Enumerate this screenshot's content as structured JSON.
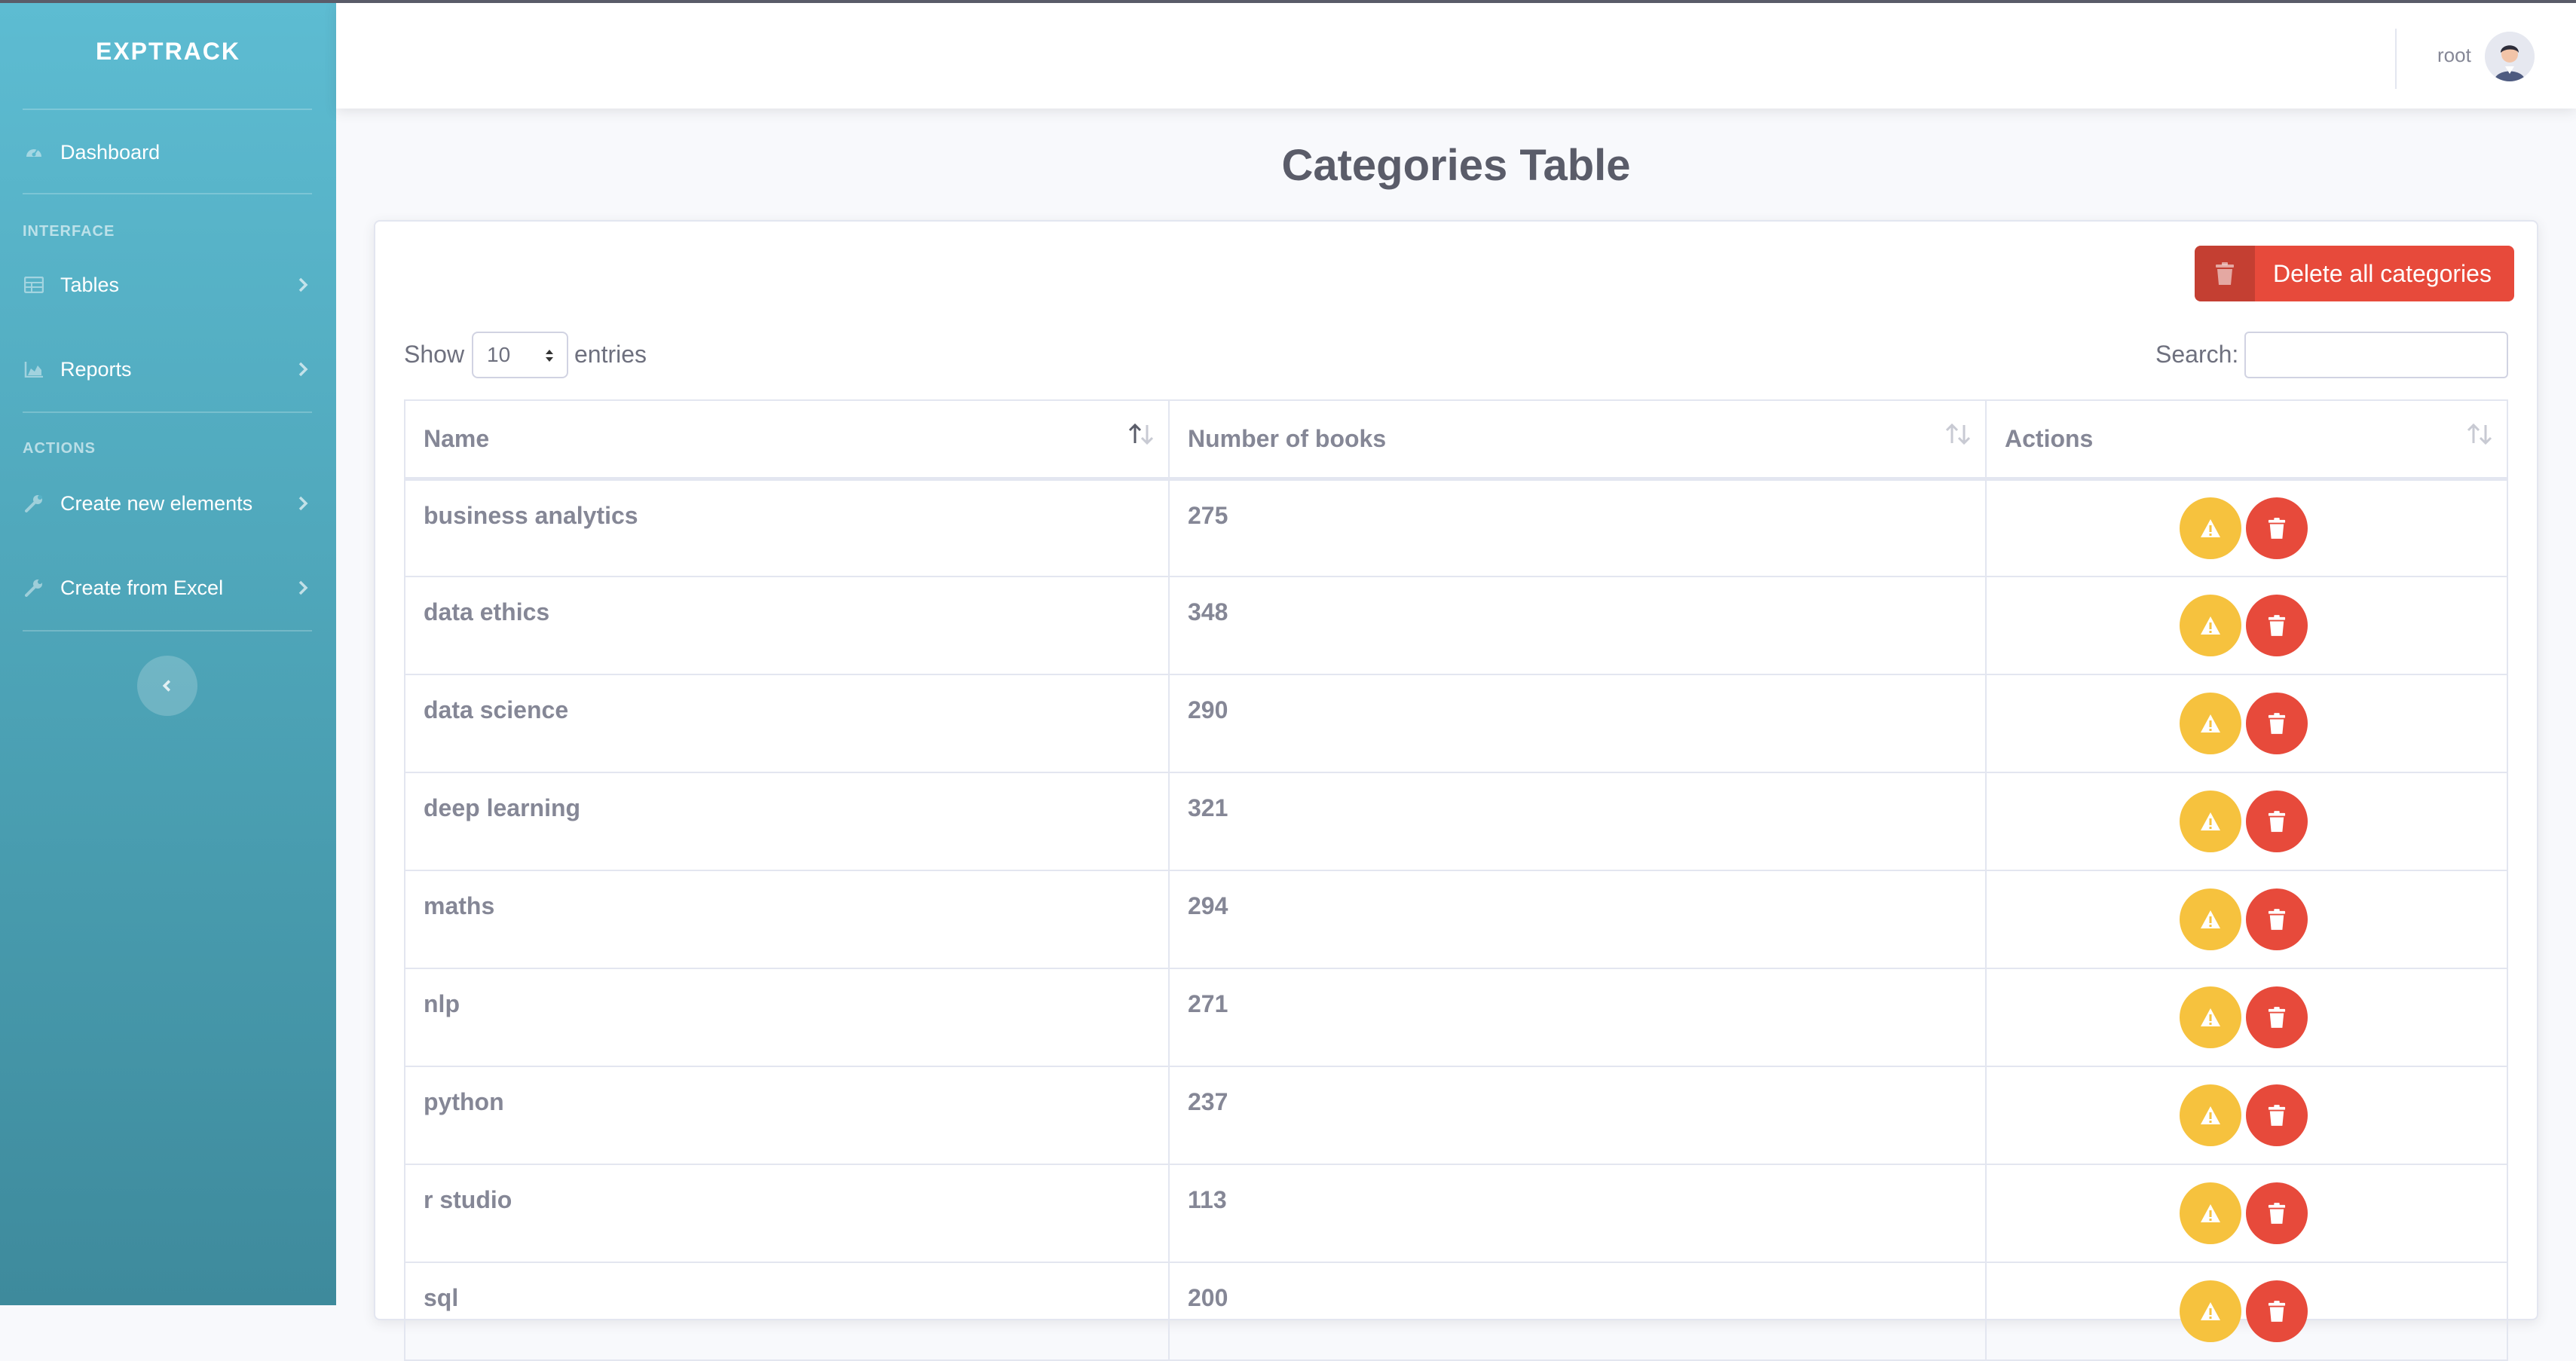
{
  "app": {
    "brand": "EXPTRACK"
  },
  "sidebar": {
    "dashboard": "Dashboard",
    "heading_interface": "INTERFACE",
    "tables": "Tables",
    "reports": "Reports",
    "heading_actions": "ACTIONS",
    "create_new": "Create new elements",
    "create_excel": "Create from Excel"
  },
  "topbar": {
    "user": "root"
  },
  "page": {
    "title": "Categories Table"
  },
  "toolbar": {
    "delete_all_label": "Delete all categories"
  },
  "table_controls": {
    "show": "Show",
    "length_value": "10",
    "entries": "entries",
    "search_label": "Search:",
    "search_value": ""
  },
  "table": {
    "headers": [
      "Name",
      "Number of books",
      "Actions"
    ],
    "rows": [
      {
        "name": "business analytics",
        "books": "275"
      },
      {
        "name": "data ethics",
        "books": "348"
      },
      {
        "name": "data science",
        "books": "290"
      },
      {
        "name": "deep learning",
        "books": "321"
      },
      {
        "name": "maths",
        "books": "294"
      },
      {
        "name": "nlp",
        "books": "271"
      },
      {
        "name": "python",
        "books": "237"
      },
      {
        "name": "r studio",
        "books": "113"
      },
      {
        "name": "sql",
        "books": "200"
      }
    ]
  },
  "colors": {
    "sidebar": "#5dbcd2",
    "danger": "#e74a3b",
    "warning": "#f6c23e",
    "text": "#858796"
  },
  "icons": {
    "dashboard": "tachometer-icon",
    "tables": "table-icon",
    "reports": "chart-area-icon",
    "create": "wrench-icon",
    "warn": "exclamation-triangle-icon",
    "delete": "trash-icon"
  }
}
